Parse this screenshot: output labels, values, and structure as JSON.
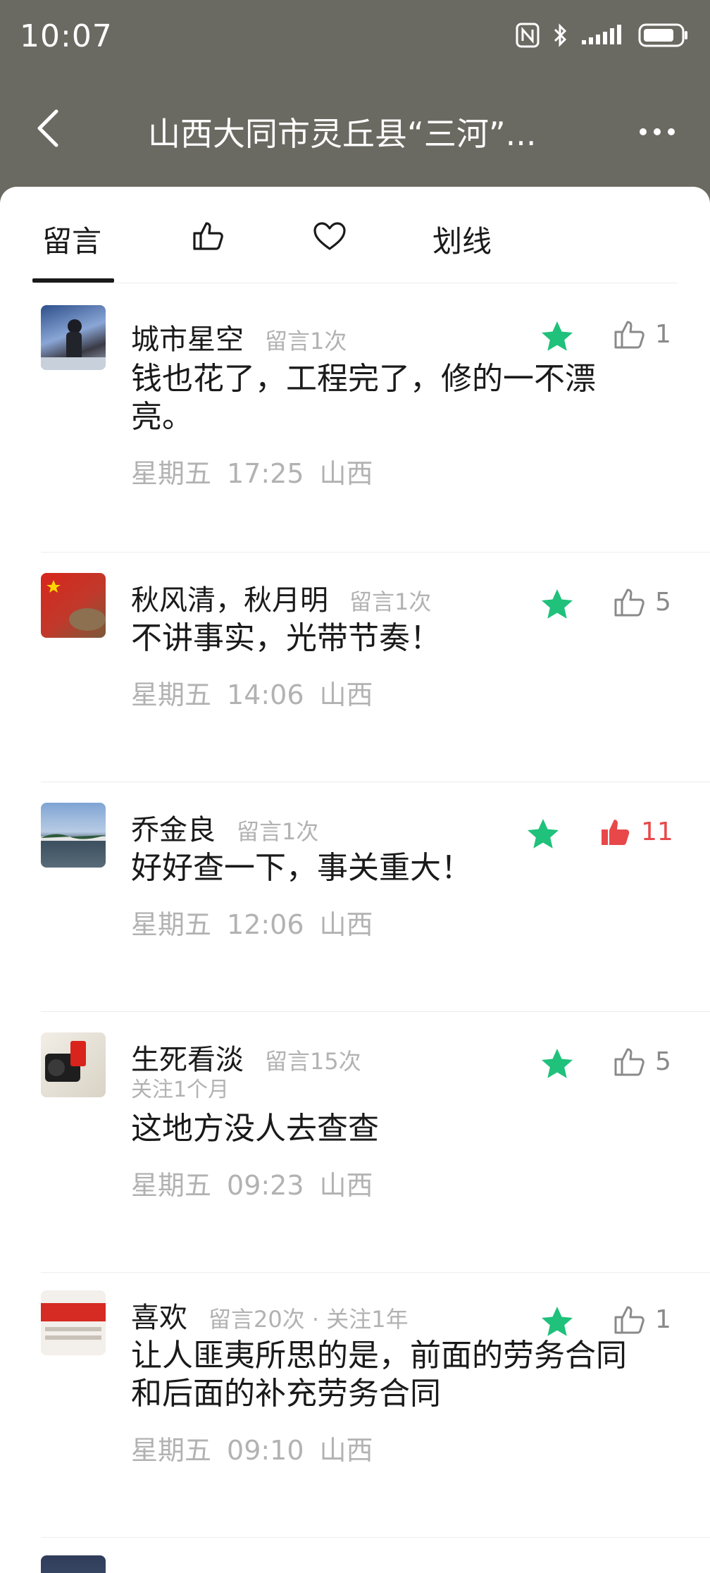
{
  "status_bar": {
    "time": "10:07"
  },
  "nav": {
    "title": "山西大同市灵丘县“三河”..."
  },
  "tabs": [
    {
      "label": "留言",
      "active": true
    },
    {
      "label": "like-tab",
      "icon": "thumbs-up-icon"
    },
    {
      "label": "favorite-tab",
      "icon": "heart-icon"
    },
    {
      "label": "划线"
    }
  ],
  "comments": [
    {
      "nickname": "城市星空",
      "count": "留言1次",
      "follow": "",
      "text": "钱也花了，工程完了，修的一不漂亮。",
      "day": "星期五",
      "time": "17:25",
      "location": "山西",
      "likes": "1",
      "liked": false
    },
    {
      "nickname": "秋风清，秋月明",
      "count": "留言1次",
      "follow": "",
      "text": "不讲事实，光带节奏！",
      "day": "星期五",
      "time": "14:06",
      "location": "山西",
      "likes": "5",
      "liked": false
    },
    {
      "nickname": "乔金良",
      "count": "留言1次",
      "follow": "",
      "text": "好好查一下，事关重大！",
      "day": "星期五",
      "time": "12:06",
      "location": "山西",
      "likes": "11",
      "liked": true
    },
    {
      "nickname": "生死看淡",
      "count": "留言15次",
      "follow": "关注1个月",
      "text": "这地方没人去查查",
      "day": "星期五",
      "time": "09:23",
      "location": "山西",
      "likes": "5",
      "liked": false
    },
    {
      "nickname": "喜欢",
      "count": "留言20次 · 关注1年",
      "follow": "",
      "text": "让人匪夷所思的是，前面的劳务合同和后面的补充劳务合同",
      "day": "星期五",
      "time": "09:10",
      "location": "山西",
      "likes": "1",
      "liked": false
    }
  ],
  "colors": {
    "star": "#1fc17b",
    "liked": "#e8484a",
    "header_bg": "#6b6a62"
  }
}
